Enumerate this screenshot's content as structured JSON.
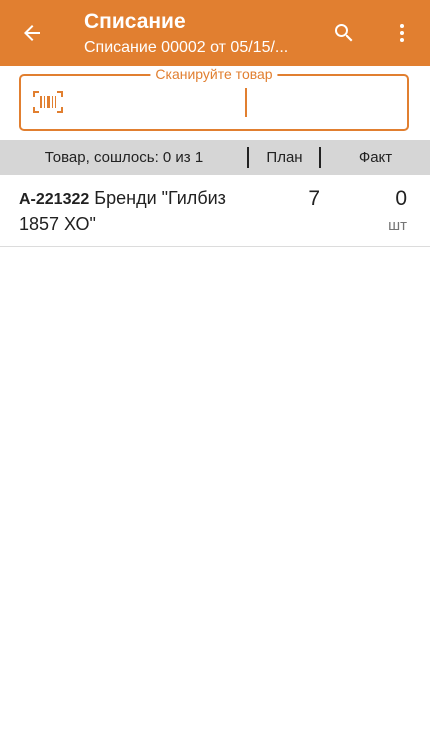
{
  "toolbar": {
    "title": "Списание",
    "subtitle": "Списание 00002 от 05/15/...",
    "accent_color": "#e17f30",
    "back_icon": "arrow-left-icon",
    "search_icon": "search-icon",
    "menu_icon": "more-vert-icon"
  },
  "scan": {
    "legend": "Сканируйте товар",
    "value": "",
    "icon": "barcode-icon"
  },
  "table": {
    "headers": {
      "name": "Товар, сошлось: 0 из 1",
      "plan": "План",
      "fact": "Факт"
    },
    "rows": [
      {
        "code": "А-221322",
        "name": "Бренди \"Гилбиз 1857 ХО\"",
        "plan": "7",
        "fact": "0",
        "unit": "шт"
      }
    ]
  }
}
